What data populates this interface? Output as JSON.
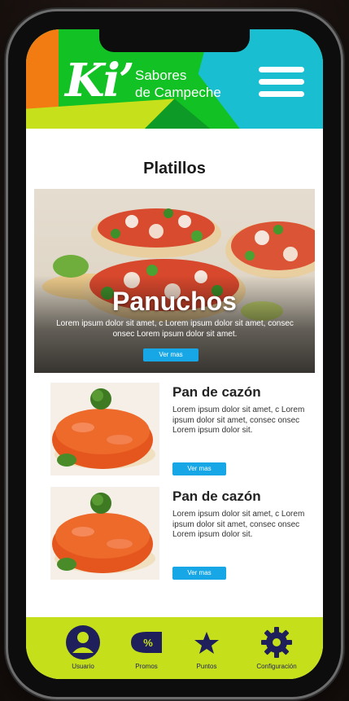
{
  "header": {
    "logo": "Ki’",
    "subtitle_line1": "Sabores",
    "subtitle_line2": "de Campeche",
    "menu_icon": "hamburger-menu-icon"
  },
  "main": {
    "section_title": "Platillos",
    "featured": {
      "title": "Panuchos",
      "description": "Lorem ipsum dolor sit amet, c Lorem ipsum dolor sit amet, consec onsec Lorem ipsum dolor sit amet.",
      "button": "Ver mas"
    },
    "items": [
      {
        "title": "Pan de cazón",
        "description": "Lorem ipsum dolor sit amet, c Lorem ipsum dolor sit amet, consec onsec Lorem ipsum dolor sit.",
        "button": "Ver mas"
      },
      {
        "title": "Pan de cazón",
        "description": "Lorem ipsum dolor sit amet, c Lorem ipsum dolor sit amet, consec onsec Lorem ipsum dolor sit.",
        "button": "Ver mas"
      }
    ]
  },
  "nav": [
    {
      "label": "Usuario",
      "icon": "user-icon"
    },
    {
      "label": "Promos",
      "icon": "percent-tag-icon"
    },
    {
      "label": "Puntos",
      "icon": "star-icon"
    },
    {
      "label": "Configuración",
      "icon": "gear-icon"
    }
  ],
  "colors": {
    "brand_green": "#12c224",
    "brand_cyan": "#19bfd1",
    "brand_orange": "#f27c12",
    "nav_lime": "#c5e01a",
    "button_blue": "#17a6e6",
    "nav_icon_navy": "#1f1f5c"
  }
}
